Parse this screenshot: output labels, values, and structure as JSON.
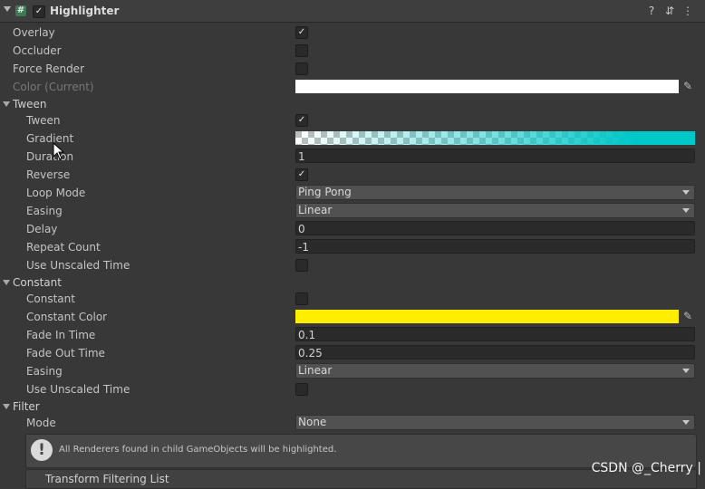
{
  "component": {
    "title": "Highlighter",
    "enabled": "✓",
    "icon_glyph": "#",
    "buttons": {
      "help": "?",
      "settings": "⇵",
      "menu": "⋮"
    }
  },
  "fields": {
    "overlay": {
      "label": "Overlay",
      "value": "✓"
    },
    "occluder": {
      "label": "Occluder",
      "value": ""
    },
    "force_render": {
      "label": "Force Render",
      "value": ""
    },
    "color_current": {
      "label": "Color (Current)",
      "color": "#ffffff"
    }
  },
  "tween": {
    "header": "Tween",
    "tween": {
      "label": "Tween",
      "value": "✓"
    },
    "gradient": {
      "label": "Gradient"
    },
    "duration": {
      "label": "Duration",
      "value": "1"
    },
    "reverse": {
      "label": "Reverse",
      "value": "✓"
    },
    "loop_mode": {
      "label": "Loop Mode",
      "value": "Ping Pong"
    },
    "easing": {
      "label": "Easing",
      "value": "Linear"
    },
    "delay": {
      "label": "Delay",
      "value": "0"
    },
    "repeat_count": {
      "label": "Repeat Count",
      "value": "-1"
    },
    "use_unscaled_time": {
      "label": "Use Unscaled Time",
      "value": ""
    }
  },
  "constant": {
    "header": "Constant",
    "constant": {
      "label": "Constant",
      "value": ""
    },
    "constant_color": {
      "label": "Constant Color",
      "color": "#ffee00"
    },
    "fade_in_time": {
      "label": "Fade In Time",
      "value": "0.1"
    },
    "fade_out_time": {
      "label": "Fade Out Time",
      "value": "0.25"
    },
    "easing": {
      "label": "Easing",
      "value": "Linear"
    },
    "use_unscaled_time": {
      "label": "Use Unscaled Time",
      "value": ""
    }
  },
  "filter": {
    "header": "Filter",
    "mode": {
      "label": "Mode",
      "value": "None"
    },
    "help_text": "All Renderers found in child GameObjects will be highlighted.",
    "list_header": "Transform Filtering List"
  },
  "watermark": "CSDN @_Cherry |"
}
